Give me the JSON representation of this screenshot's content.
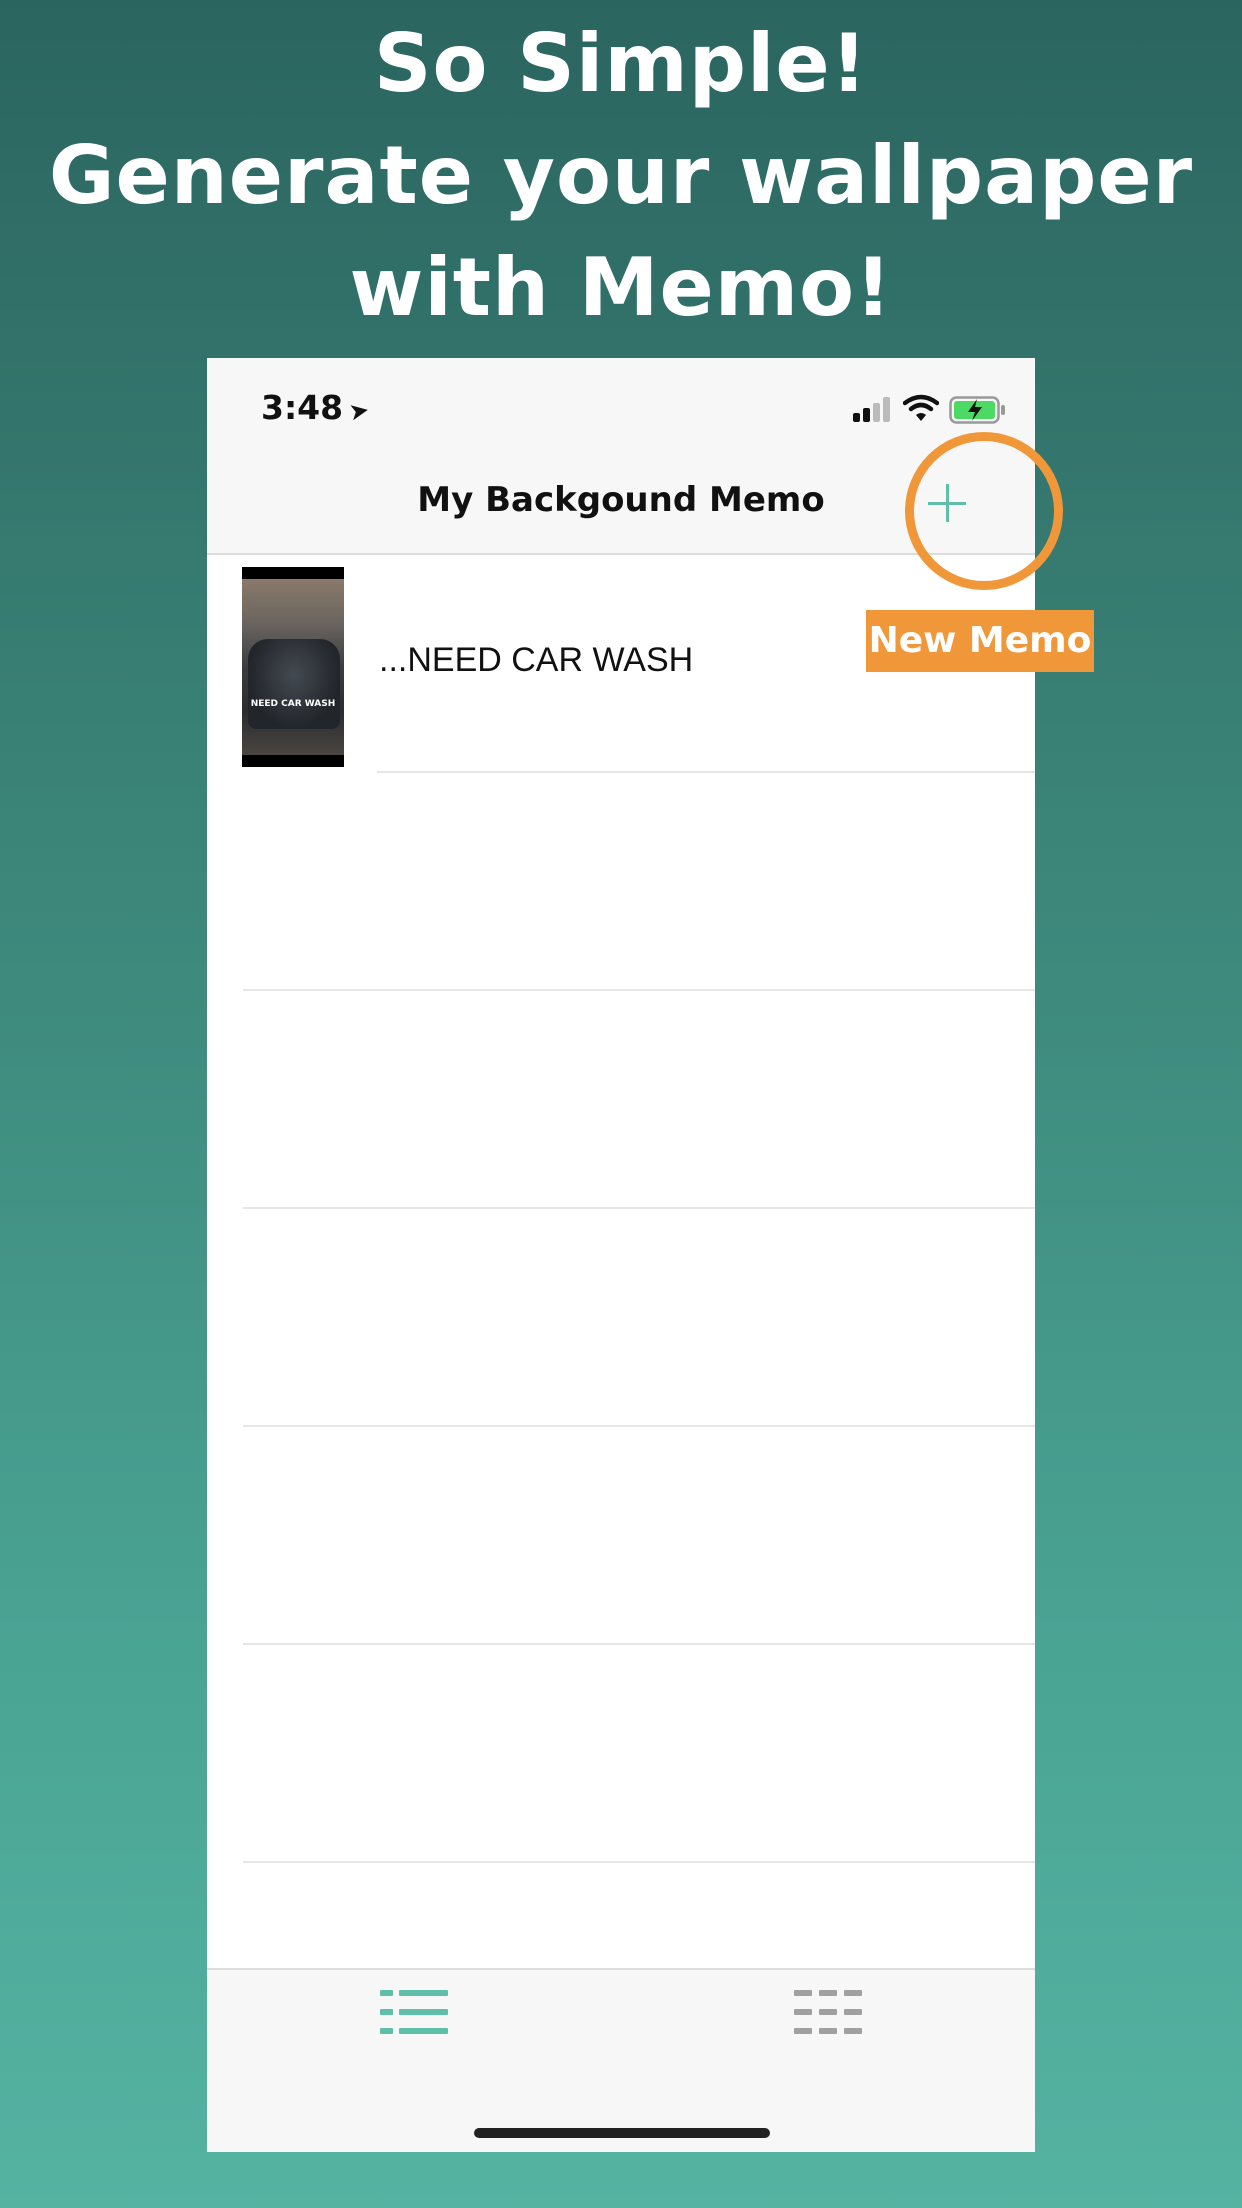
{
  "headline": {
    "line1": "So Simple!",
    "line2": "Generate your wallpaper",
    "line3": "with Memo!"
  },
  "status_bar": {
    "time": "3:48",
    "location_icon": "location-arrow-icon",
    "signal_icon": "cellular-signal-icon",
    "wifi_icon": "wifi-icon",
    "battery_icon": "battery-charging-icon"
  },
  "navbar": {
    "title": "My Backgound Memo",
    "add_icon": "plus-icon"
  },
  "memos": [
    {
      "text": "...NEED CAR WASH",
      "thumbnail_caption": "NEED CAR WASH"
    }
  ],
  "tabbar": {
    "tabs": [
      {
        "icon": "list-icon",
        "active": true
      },
      {
        "icon": "grid-icon",
        "active": false
      }
    ]
  },
  "annotation": {
    "callout": "New Memo"
  },
  "colors": {
    "accent": "#5fbfa8",
    "highlight": "#f0973a",
    "background_top": "#2b6560",
    "background_bottom": "#55b3a2"
  }
}
